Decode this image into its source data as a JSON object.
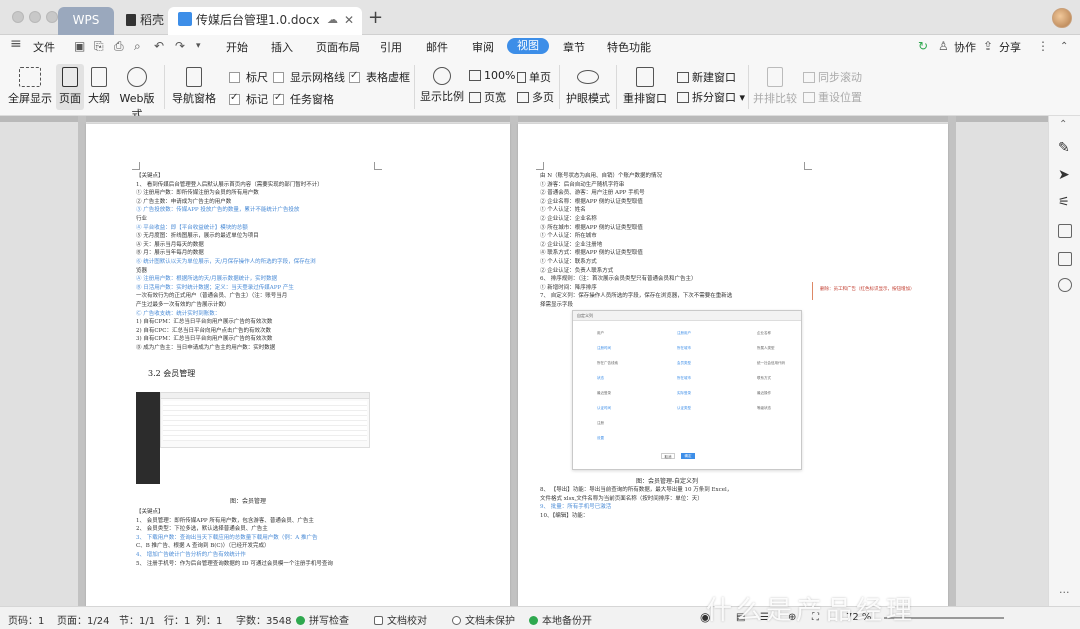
{
  "titlebar": {
    "tabs": [
      "WPS",
      "稻壳",
      "传媒后台管理1.0.docx"
    ],
    "new_tab": "+",
    "close": "✕"
  },
  "menubar": {
    "file": "文件",
    "items": [
      "开始",
      "插入",
      "页面布局",
      "引用",
      "邮件",
      "审阅",
      "视图",
      "章节",
      "特色功能"
    ],
    "active": "视图",
    "collab": "协作",
    "share": "分享"
  },
  "ribbon": {
    "fullscreen": "全屏显示",
    "page": "页面",
    "outline": "大纲",
    "web": "Web版式",
    "nav_pane": "导航窗格",
    "ruler": "标尺",
    "show_grid": "显示网格线",
    "table_dashed": "表格虚框",
    "mark": "标记",
    "task_pane": "任务窗格",
    "zoom": "显示比例",
    "zoom100": "100%",
    "page_width": "页宽",
    "single_page": "单页",
    "multi_page": "多页",
    "eye_mode": "护眼模式",
    "rearrange": "重排窗口",
    "new_window": "新建窗口",
    "split_window": "拆分窗口",
    "compare": "并排比较",
    "sync_scroll": "同步滚动",
    "reset_pos": "重设位置"
  },
  "document": {
    "left": {
      "lines": [
        "【关键点】",
        "1、 看到传媒后台管理登入后默认展示首页内容（需要实现的部门暂时不计）",
        "   ① 注册用户数：即所传媒注册为会员的所有用户数",
        "   ② 广告主数：申请成为广告主的用户数",
        "   ③ 广告投放数：传媒APP 投放广告的数量，累计不能统计广告投放",
        "      行业",
        "   ④ 平台收益：即【平台收益统计】模块的总额",
        "   ⑤ 无月度图：折线图展示，展示的最近单位为项目",
        "      Ⓐ 天：展示当月每天的数据",
        "      Ⓑ 月：展示当年每月的数据",
        "   ⑥ 统计图默认以天为单位展示，天/月保存操作人的所选的字段，保存在浏",
        "      览器",
        "      Ⓐ 注册用户数：根据所选的天/月展示数据统计，实时数据",
        "      Ⓑ 日活用户数：实时统计数据；定义：当天登录过传媒APP 产生",
        "         一次有效行为的正式用户（普通会员、广告主）（注：账号当月",
        "         产生过最多一次有效的广告展示计数）",
        "      Ⓒ 广告收支统：统计实时到账数：",
        "         1) 自有CPM：汇总当日平台向用户展示广告的有效次数",
        "         2) 自有CPC：汇总当日平台向用户点击广告的有效次数",
        "         3) 自有CPM：汇总当日平台向用户展示广告的有效次数",
        "      Ⓓ 成为广告主：当日申请成为广告主的用户数：实时数据"
      ],
      "section_title": "3.2 会员管理",
      "figure_caption": "图：会员管理",
      "bottom_lines": [
        "【关键点】",
        "1、 会员管理：即所传媒APP 所有用户数，包含游客、普通会员、广告主",
        "2、 会员类型：下拉多选，默认选择普通会员、广告主",
        "3、 下载用户数：查询出当天下载应用的总数量下载用户数（例：A 推广告",
        "   C、B 推广告、根据 A 查询到 B(C)）（已经开发完成）",
        "4、 增加广告统计广告分析的广告有效统计作",
        "5、 注册手机号：作为后台管理查询数据的 ID 可通过会员模一个注册手机号查询"
      ]
    },
    "right": {
      "lines": [
        "由 N（账号状态为启用、自销）个账户数据的情况",
        "      ① 游客：后台自动生产随机字符串",
        "      ② 普通会员、游客：用户注册 APP 手机号",
        "   ② 企业名称：根据APP 侧的认证类型取值",
        "      ① 个人认证：姓名",
        "      ② 企业认证：企业名称",
        "   ③ 所在城市：根据APP 侧的认证类型取值",
        "      ① 个人认证：所在城市",
        "      ② 企业认证：企业注册地",
        "   ④ 联系方式：根据APP 侧的认证类型取值",
        "      ① 个人认证：联系方式",
        "      ② 企业认证：负责人联系方式",
        "6、 排序规则：（注：首次展示会员类型只有普通会员和广告主）",
        "   ① 新增时间：降序排序",
        "7、 自定义列：保存操作人员所选的字段，保存在浏览器，下次不需要在重新选",
        "   择需显示字段"
      ],
      "figure_caption": "图：会员管理-自定义列",
      "bottom_lines": [
        "8、 【导出】功能：导出当前查询的所有数据，最大导出量 10 万条到 Excel，",
        "   文件格式 xlsx,文件名称为当前页面名称（按时间排序：单位：天）",
        "9、 批量：所有手机号已激活",
        "10、【编辑】功能："
      ],
      "dialog": {
        "title": "自定义列",
        "cells": [
          [
            "用户",
            "注册用户",
            "企业名称"
          ],
          [
            "注册时间",
            "所在城市",
            "所属人类型"
          ],
          [
            "所在广告线索",
            "会员类型",
            "统一社会信用代码"
          ],
          [
            "状态",
            "所在城市",
            "联系方式"
          ],
          [
            "最近登录",
            "实际登录",
            "最近操作"
          ],
          [
            "认证时间",
            "认证类型",
            "等级状态"
          ],
          [
            "注册",
            "",
            ""
          ],
          [
            "设置",
            "",
            ""
          ]
        ],
        "cancel": "取消",
        "ok": "确定"
      },
      "comment": "删除：员工和广告（红色标识显示，按钮增加）"
    }
  },
  "statusbar": {
    "page_no": "页码：1",
    "page": "页面：1/24",
    "section": "节：1/1",
    "row": "行：1",
    "col": "列：1",
    "words": "字数：3548",
    "spell": "拼写检查",
    "proof": "文档校对",
    "unprotected": "文档未保护",
    "backup": "本地备份开",
    "zoom": "72 %"
  },
  "watermark": "什么是产品经理",
  "colors": {
    "accent": "#3d8ee8",
    "wps_tab": "#9aa8bd",
    "green_status": "#2fa84f",
    "comment_red": "#c0392b"
  }
}
